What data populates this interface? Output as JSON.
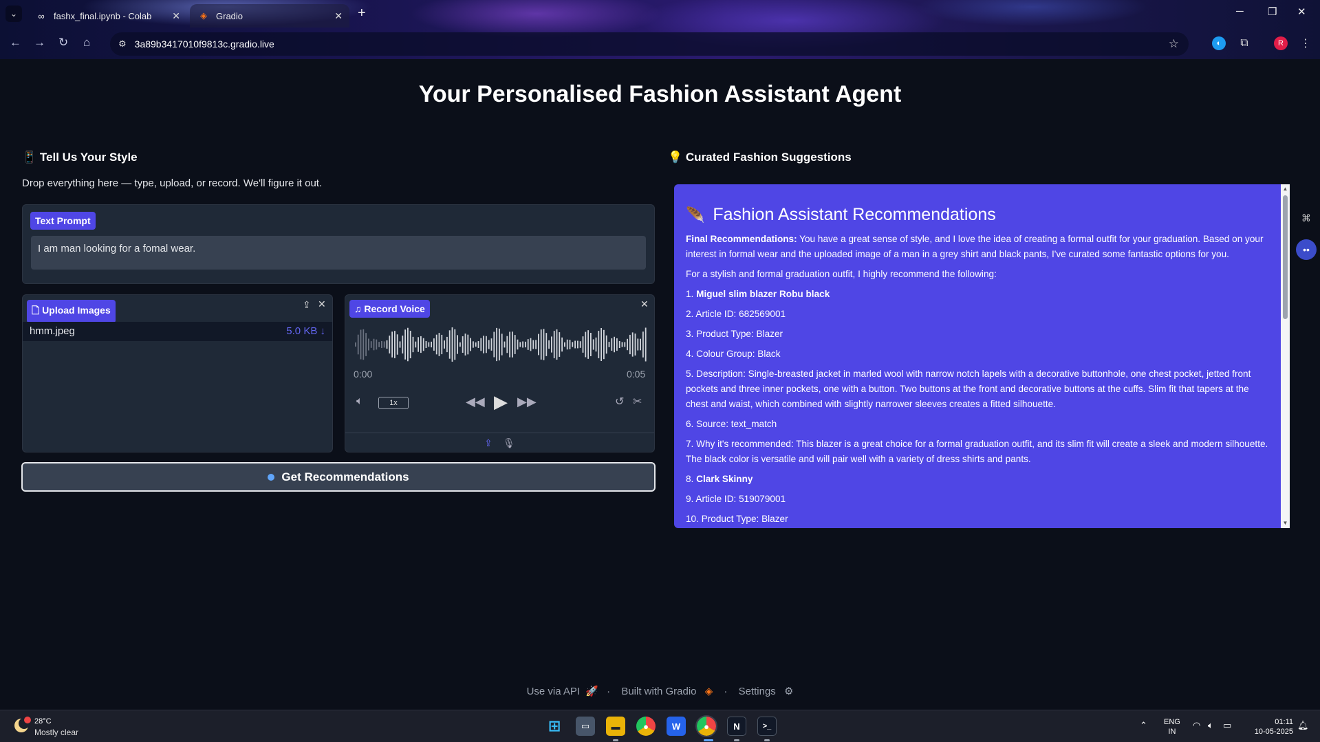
{
  "browser": {
    "tabs": [
      {
        "title": "fashx_final.ipynb - Colab",
        "icon": "colab-icon"
      },
      {
        "title": "Gradio",
        "icon": "gradio-icon"
      }
    ],
    "url": "3a89b3417010f9813c.gradio.live",
    "profile_initial": "R"
  },
  "page": {
    "title": "Your Personalised Fashion Assistant Agent",
    "left_heading": "Tell Us Your Style",
    "left_heading_icon": "📱",
    "description": "Drop everything here — type, upload, or record. We'll figure it out.",
    "right_heading": "Curated Fashion Suggestions",
    "right_heading_icon": "💡"
  },
  "text_prompt": {
    "label": "Text Prompt",
    "value": "I am man looking for a fomal wear."
  },
  "upload": {
    "label": "Upload Images",
    "file_name": "hmm.jpeg",
    "file_size": "5.0 KB ↓"
  },
  "voice": {
    "label": "Record Voice",
    "time_start": "0:00",
    "time_end": "0:05",
    "speed": "1x"
  },
  "get_button": "Get Recommendations",
  "recommendations": {
    "heading": "Fashion Assistant Recommendations",
    "heading_icon": "🪶",
    "final_label": "Final Recommendations:",
    "final_text": " You have a great sense of style, and I love the idea of creating a formal outfit for your graduation. Based on your interest in formal wear and the uploaded image of a man in a grey shirt and black pants, I've curated some fantastic options for you.",
    "intro": "For a stylish and formal graduation outfit, I highly recommend the following:",
    "items": [
      {
        "prefix": "1. ",
        "bold": "Miguel slim blazer Robu black",
        "text": ""
      },
      {
        "prefix": "2. ",
        "bold": "",
        "text": "Article ID: 682569001"
      },
      {
        "prefix": "3. ",
        "bold": "",
        "text": "Product Type: Blazer"
      },
      {
        "prefix": "4. ",
        "bold": "",
        "text": "Colour Group: Black"
      },
      {
        "prefix": "5. ",
        "bold": "",
        "text": "Description: Single-breasted jacket in marled wool with narrow notch lapels with a decorative buttonhole, one chest pocket, jetted front pockets and three inner pockets, one with a button. Two buttons at the front and decorative buttons at the cuffs. Slim fit that tapers at the chest and waist, which combined with slightly narrower sleeves creates a fitted silhouette."
      },
      {
        "prefix": "6. ",
        "bold": "",
        "text": "Source: text_match"
      },
      {
        "prefix": "7. ",
        "bold": "",
        "text": "Why it's recommended: This blazer is a great choice for a formal graduation outfit, and its slim fit will create a sleek and modern silhouette. The black color is versatile and will pair well with a variety of dress shirts and pants."
      },
      {
        "prefix": "8. ",
        "bold": "Clark Skinny",
        "text": ""
      },
      {
        "prefix": "9. ",
        "bold": "",
        "text": "Article ID: 519079001"
      },
      {
        "prefix": "10. ",
        "bold": "",
        "text": "Product Type: Blazer"
      }
    ]
  },
  "footer": {
    "api": "Use via API",
    "built": "Built with Gradio",
    "settings": "Settings",
    "sep": "·"
  },
  "taskbar": {
    "temperature": "28°C",
    "condition": "Mostly clear",
    "lang_line1": "ENG",
    "lang_line2": "IN",
    "time": "01:11",
    "date": "10-05-2025"
  },
  "colors": {
    "accent": "#4f46e5",
    "page_bg": "#0b0f19",
    "block_bg": "#1f2937"
  }
}
